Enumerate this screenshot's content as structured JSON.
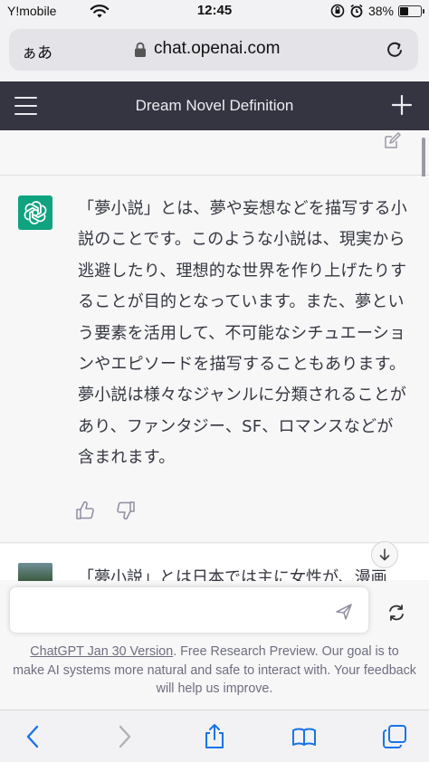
{
  "status_bar": {
    "carrier": "Y!mobile",
    "time": "12:45",
    "battery_text": "38%",
    "battery_level": 0.38
  },
  "browser": {
    "text_size_label": "ぁあ",
    "domain": "chat.openai.com"
  },
  "app": {
    "title": "Dream Novel Definition"
  },
  "messages": {
    "assistant_text": "「夢小説」とは、夢や妄想などを描写する小説のことです。このような小説は、現実から逃避したり、理想的な世界を作り上げたりすることが目的となっています。また、夢という要素を活用して、不可能なシチュエーションやエピソードを描写することもあります。夢小説は様々なジャンルに分類されることがあり、ファンタジー、SF、ロマンスなどが含まれます。",
    "next_text": "「夢小説」とは日本では主に女性が、漫画"
  },
  "composer": {
    "input_value": "",
    "footer_link": "ChatGPT Jan 30 Version",
    "footer_text": ". Free Research Preview. Our goal is to make AI systems more natural and safe to interact with. Your feedback will help us improve."
  },
  "icons": {
    "wifi": "wifi-icon",
    "lock": "lock-icon",
    "reload": "reload-icon",
    "menu": "hamburger-icon",
    "new_chat": "plus-icon",
    "edit": "edit-icon",
    "openai": "openai-logo-icon",
    "thumbs_up": "thumbs-up-icon",
    "thumbs_down": "thumbs-down-icon",
    "scroll_down": "arrow-down-icon",
    "send": "send-icon",
    "regenerate": "regenerate-icon",
    "back": "back-icon",
    "forward": "forward-icon",
    "share": "share-icon",
    "bookmarks": "book-icon",
    "tabs": "tabs-icon"
  },
  "colors": {
    "header_bg": "#343541",
    "openai_green": "#10a37f"
  }
}
